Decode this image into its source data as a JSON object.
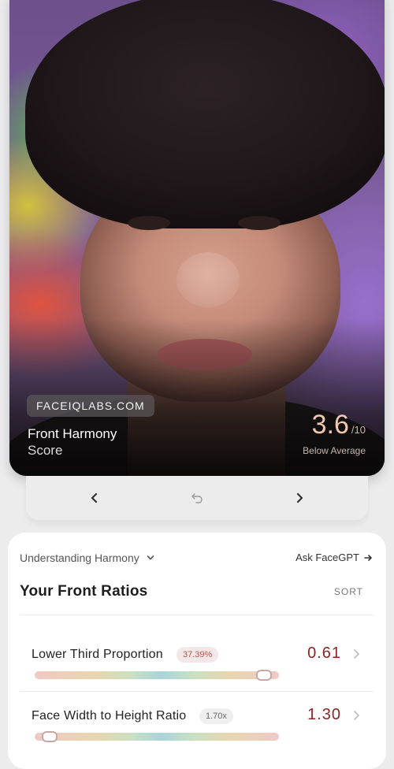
{
  "photo_card": {
    "watermark": "FACEIQLABS.COM",
    "title": "Front Harmony",
    "subtitle": "Score",
    "score": "3.6",
    "score_max": "/10",
    "verdict": "Below Average"
  },
  "nav": {
    "prev_icon": "chevron-left-icon",
    "undo_icon": "undo-icon",
    "next_icon": "chevron-right-icon"
  },
  "panel": {
    "understanding_label": "Understanding Harmony",
    "ask_label": "Ask FaceGPT",
    "section_title": "Your Front Ratios",
    "sort_label": "SORT",
    "ratios": [
      {
        "label": "Lower Third Proportion",
        "badge": "37.39%",
        "value": "0.61",
        "position": 0.97
      },
      {
        "label": "Face Width to Height Ratio",
        "badge": "1.70x",
        "value": "1.30",
        "position": 0.03
      }
    ]
  },
  "colors": {
    "score_accent": "#f0c8b0",
    "value_red": "#8b2324",
    "background": "#ececed"
  }
}
